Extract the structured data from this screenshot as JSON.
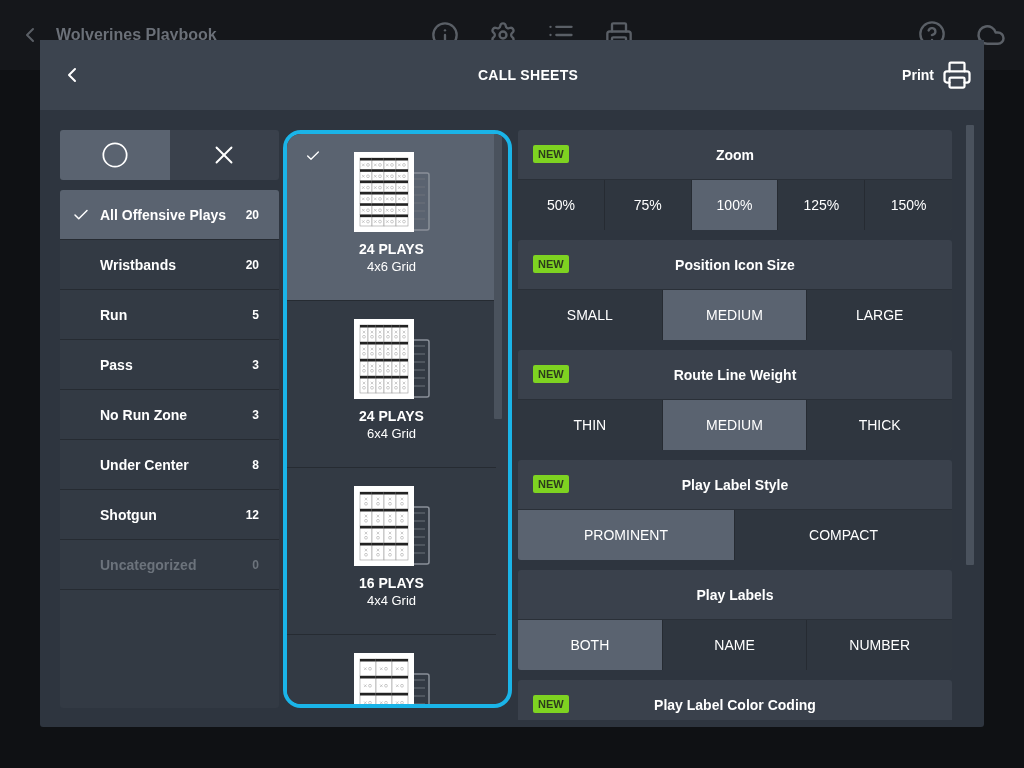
{
  "app_header": {
    "title": "Wolverines Playbook"
  },
  "dialog": {
    "title": "CALL SHEETS",
    "print_label": "Print"
  },
  "mode_toggle": [
    {
      "kind": "circle",
      "selected": true
    },
    {
      "kind": "cross",
      "selected": false
    }
  ],
  "categories": [
    {
      "label": "All Offensive Plays",
      "count": "20",
      "selected": true,
      "disabled": false
    },
    {
      "label": "Wristbands",
      "count": "20",
      "selected": false,
      "disabled": false
    },
    {
      "label": "Run",
      "count": "5",
      "selected": false,
      "disabled": false
    },
    {
      "label": "Pass",
      "count": "3",
      "selected": false,
      "disabled": false
    },
    {
      "label": "No Run Zone",
      "count": "3",
      "selected": false,
      "disabled": false
    },
    {
      "label": "Under Center",
      "count": "8",
      "selected": false,
      "disabled": false
    },
    {
      "label": "Shotgun",
      "count": "12",
      "selected": false,
      "disabled": false
    },
    {
      "label": "Uncategorized",
      "count": "0",
      "selected": false,
      "disabled": true
    }
  ],
  "layouts": [
    {
      "plays": "24 PLAYS",
      "grid": "4x6 Grid",
      "kind": "tall",
      "selected": true
    },
    {
      "plays": "24 PLAYS",
      "grid": "6x4 Grid",
      "kind": "wide",
      "selected": false
    },
    {
      "plays": "16 PLAYS",
      "grid": "4x4 Grid",
      "kind": "square",
      "selected": false
    },
    {
      "kind": "triple",
      "selected": false
    }
  ],
  "settings": [
    {
      "title": "Zoom",
      "badge": "NEW",
      "options": [
        {
          "label": "50%",
          "selected": false
        },
        {
          "label": "75%",
          "selected": false
        },
        {
          "label": "100%",
          "selected": true
        },
        {
          "label": "125%",
          "selected": false
        },
        {
          "label": "150%",
          "selected": false
        }
      ]
    },
    {
      "title": "Position Icon Size",
      "badge": "NEW",
      "options": [
        {
          "label": "SMALL",
          "selected": false
        },
        {
          "label": "MEDIUM",
          "selected": true
        },
        {
          "label": "LARGE",
          "selected": false
        }
      ]
    },
    {
      "title": "Route Line Weight",
      "badge": "NEW",
      "options": [
        {
          "label": "THIN",
          "selected": false
        },
        {
          "label": "MEDIUM",
          "selected": true
        },
        {
          "label": "THICK",
          "selected": false
        }
      ]
    },
    {
      "title": "Play Label Style",
      "badge": "NEW",
      "options": [
        {
          "label": "PROMINENT",
          "selected": true
        },
        {
          "label": "COMPACT",
          "selected": false
        }
      ]
    },
    {
      "title": "Play Labels",
      "options": [
        {
          "label": "BOTH",
          "selected": true
        },
        {
          "label": "NAME",
          "selected": false
        },
        {
          "label": "NUMBER",
          "selected": false
        }
      ]
    },
    {
      "title": "Play Label Color Coding",
      "badge": "NEW"
    }
  ]
}
